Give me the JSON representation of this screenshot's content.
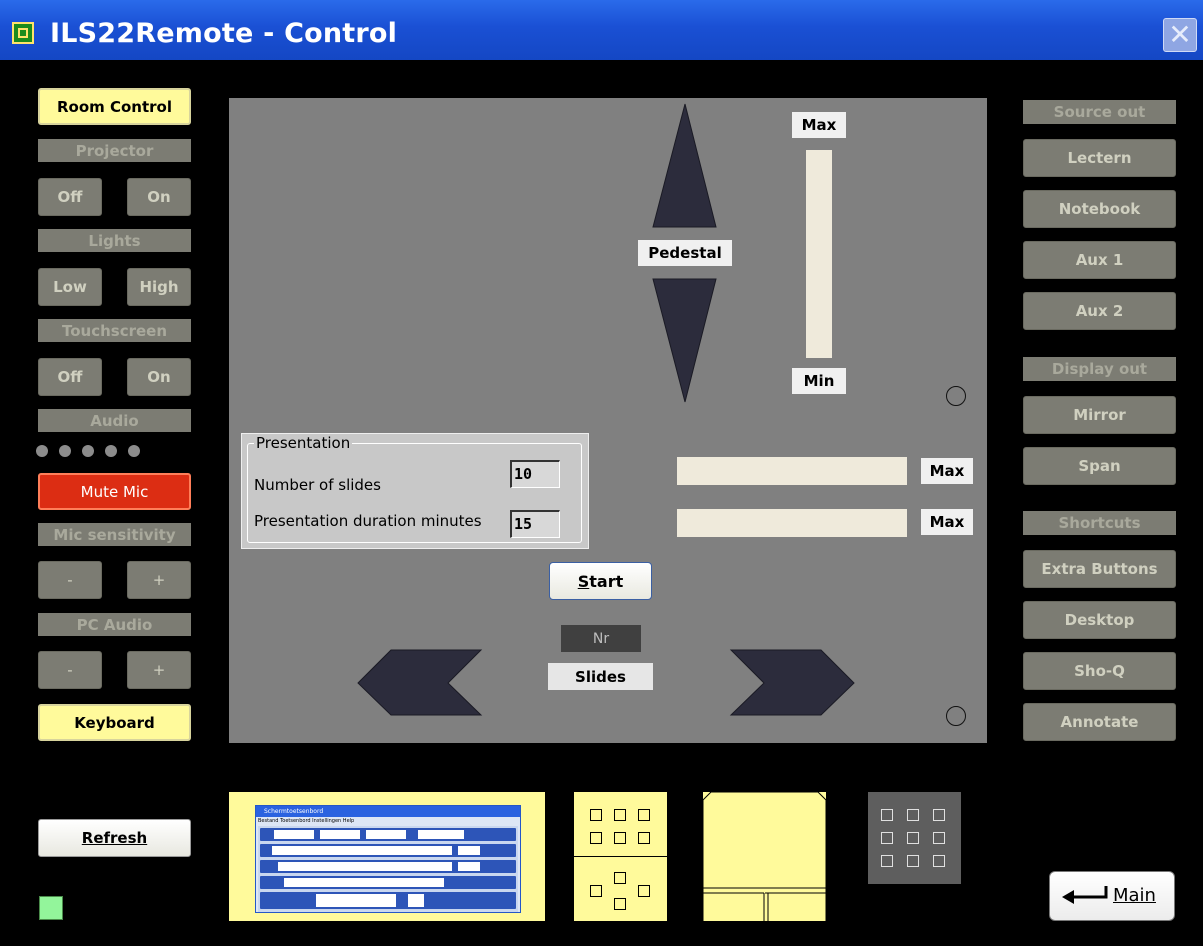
{
  "window": {
    "title": "ILS22Remote - Control",
    "close_symbol": "✕"
  },
  "left": {
    "room_control": "Room Control",
    "projector": {
      "header": "Projector",
      "off": "Off",
      "on": "On"
    },
    "lights": {
      "header": "Lights",
      "low": "Low",
      "high": "High"
    },
    "touchscreen": {
      "header": "Touchscreen",
      "off": "Off",
      "on": "On"
    },
    "audio": {
      "header": "Audio",
      "level_dots": 5
    },
    "mute_mic": "Mute Mic",
    "mic_sensitivity": {
      "header": "Mic sensitivity",
      "minus": "-",
      "plus": "+"
    },
    "pc_audio": {
      "header": "PC Audio",
      "minus": "-",
      "plus": "+"
    },
    "keyboard": "Keyboard",
    "refresh": "Refresh"
  },
  "center": {
    "pedestal": {
      "label": "Pedestal",
      "max": "Max",
      "min": "Min"
    },
    "presentation": {
      "legend": "Presentation",
      "slides_label": "Number of slides",
      "slides_value": "10",
      "duration_label": "Presentation duration minutes",
      "duration_value": "15"
    },
    "progress_max_1": "Max",
    "progress_max_2": "Max",
    "start": "Start",
    "start_mnemonic": "S",
    "start_rest": "tart",
    "nr": "Nr",
    "slides": "Slides"
  },
  "right": {
    "source_out": {
      "header": "Source out",
      "items": [
        "Lectern",
        "Notebook",
        "Aux 1",
        "Aux 2"
      ]
    },
    "display_out": {
      "header": "Display out",
      "items": [
        "Mirror",
        "Span"
      ]
    },
    "shortcuts": {
      "header": "Shortcuts",
      "items": [
        "Extra Buttons",
        "Desktop",
        "Sho-Q",
        "Annotate"
      ]
    }
  },
  "bottom": {
    "main_button": "Main",
    "osk_title": "Schermtoetsenbord",
    "osk_menu": "Bestand  Toetsenbord  Instellingen  Help"
  },
  "colors": {
    "title_bar": "#1a50d4",
    "yellow_button": "#fffa9b",
    "gray_button": "#7c7c73",
    "mute_red": "#dc2d13",
    "panel_bg": "#808080",
    "arrow_fill": "#2c2c3c",
    "status_green": "#93f59b"
  }
}
